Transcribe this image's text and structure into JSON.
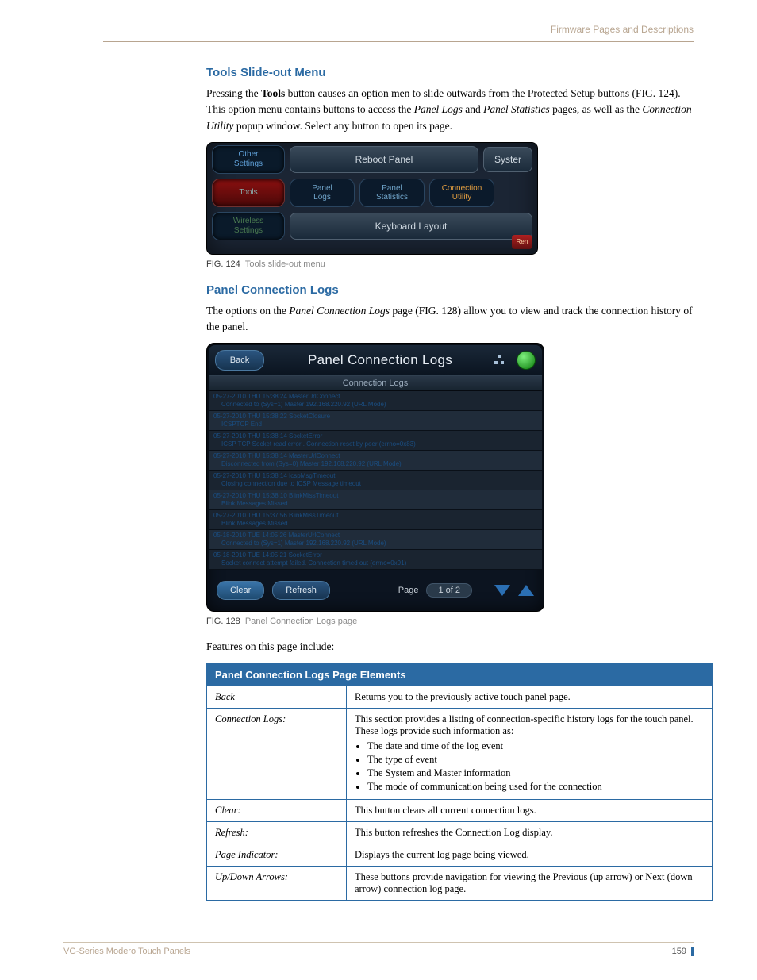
{
  "header": {
    "breadcrumb": "Firmware Pages and Descriptions"
  },
  "sec1": {
    "heading": "Tools Slide-out Menu",
    "para_pre": "Pressing the ",
    "para_bold1": "Tools",
    "para_mid1": " button causes an option men to slide outwards from the Protected Setup buttons (FIG. 124). This option menu contains buttons to access the ",
    "para_ital1": "Panel Logs",
    "para_mid2": " and ",
    "para_ital2": "Panel Statistics",
    "para_mid3": " pages, as well as the ",
    "para_ital3": "Connection Utility",
    "para_end": " popup window. Select any button to open its page."
  },
  "fig1": {
    "other_settings": "Other\nSettings",
    "tools": "Tools",
    "wireless_settings": "Wireless\nSettings",
    "reboot_panel": "Reboot Panel",
    "keyboard_layout": "Keyboard Layout",
    "panel_logs": "Panel\nLogs",
    "panel_statistics": "Panel\nStatistics",
    "connection_utility": "Connection\nUtility",
    "system": "Syster",
    "rem": "Ren",
    "caption_fignum": "FIG. 124",
    "caption": "Tools slide-out menu"
  },
  "sec2": {
    "heading": "Panel Connection Logs",
    "para_pre": "The options on the ",
    "para_ital1": "Panel Connection Logs",
    "para_end": " page (FIG. 128) allow you to view and track the connection history of the panel."
  },
  "fig2": {
    "back": "Back",
    "title": "Panel Connection Logs",
    "subheader": "Connection Logs",
    "logs": [
      {
        "l1": "05-27-2010 THU 15:38:24 MasterUrlConnect",
        "l2": "Connected to (Sys=1) Master 192.168.220.92 (URL Mode)"
      },
      {
        "l1": "05-27-2010 THU 15:38:22 SocketClosure",
        "l2": "ICSPTCP End"
      },
      {
        "l1": "05-27-2010 THU 15:38:14 SocketError",
        "l2": "ICSP TCP Socket read error:. Connection reset by peer (errno=0x83)"
      },
      {
        "l1": "05-27-2010 THU 15:38:14 MasterUrlConnect",
        "l2": "Disconnected from (Sys=0) Master 192.168.220.92 (URL Mode)"
      },
      {
        "l1": "05-27-2010 THU 15:38:14 IcspMsgTimeout",
        "l2": "Closing connection due to ICSP Message timeout"
      },
      {
        "l1": "05-27-2010 THU 15:38:10 BlinkMissTimeout",
        "l2": "Blink Messages Missed"
      },
      {
        "l1": "05-27-2010 THU 15:37:56 BlinkMissTimeout",
        "l2": "Blink Messages Missed"
      },
      {
        "l1": "05-18-2010 TUE 14:05:26 MasterUrlConnect",
        "l2": "Connected to (Sys=1) Master 192.168.220.92 (URL Mode)"
      },
      {
        "l1": "05-18-2010 TUE 14:05:21 SocketError",
        "l2": "Socket connect attempt failed. Connection timed out (errno=0x91)"
      }
    ],
    "clear": "Clear",
    "refresh": "Refresh",
    "page_label": "Page",
    "page_num": "1 of 2",
    "caption_fignum": "FIG. 128",
    "caption": "Panel Connection Logs page"
  },
  "features_intro": "Features on this page include:",
  "table": {
    "title": "Panel Connection Logs Page Elements",
    "rows": [
      {
        "label": "Back",
        "desc": "Returns you to the previously active touch panel page."
      },
      {
        "label": "Connection Logs:",
        "desc": "This section provides a listing of connection-specific history logs for the touch panel. These logs provide such information as:",
        "bullets": [
          "The date and time of the log event",
          "The type of event",
          "The System and Master information",
          "The mode of communication being used for the connection"
        ]
      },
      {
        "label": "Clear:",
        "desc": "This button clears all current connection logs."
      },
      {
        "label": "Refresh:",
        "desc": "This button refreshes the Connection Log display."
      },
      {
        "label": "Page Indicator:",
        "desc": "Displays the current log page being viewed."
      },
      {
        "label": "Up/Down Arrows:",
        "desc": "These buttons provide navigation for viewing the Previous (up arrow) or Next (down arrow) connection log page."
      }
    ]
  },
  "footer": {
    "left": "VG-Series Modero Touch Panels",
    "page": "159"
  }
}
